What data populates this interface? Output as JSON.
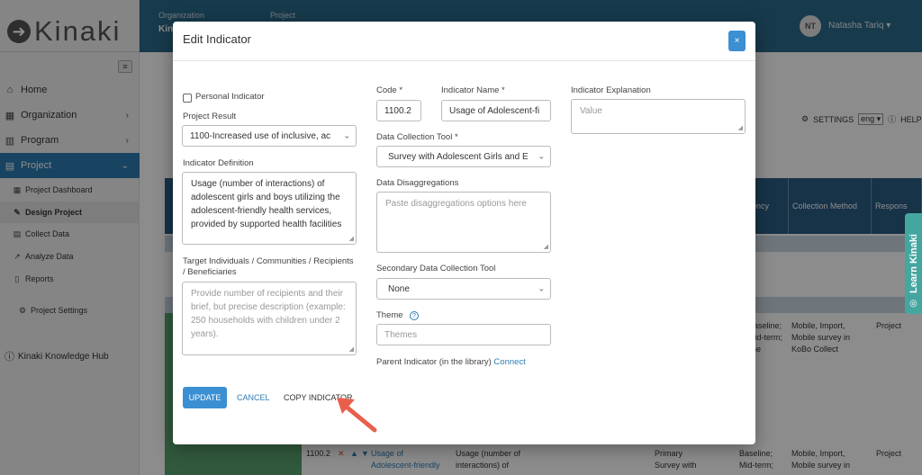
{
  "app": {
    "logo_text": "Kinaki",
    "topbar": {
      "org_label": "Organization",
      "org_value": "Kin",
      "project_label": "Project",
      "user_initials": "NT",
      "user_name": "Natasha Tariq ▾"
    }
  },
  "sidebar": {
    "collapse_icon": "≡",
    "items": [
      {
        "label": "Home",
        "icon": "⌂"
      },
      {
        "label": "Organization",
        "icon": "▦"
      },
      {
        "label": "Program",
        "icon": "▥"
      },
      {
        "label": "Project",
        "icon": "▤"
      }
    ],
    "sub_items": [
      {
        "label": "Project Dashboard"
      },
      {
        "label": "Design Project"
      },
      {
        "label": "Collect Data"
      },
      {
        "label": "Analyze Data"
      },
      {
        "label": "Reports"
      },
      {
        "label": "Project Settings"
      }
    ],
    "hub_label": "Kinaki Knowledge Hub"
  },
  "background": {
    "settings_label": "SETTINGS",
    "lang_value": "eng ▾",
    "help_label": "HELP",
    "table_headers": {
      "frequency": "uency",
      "collection_method": "Collection Method",
      "responsible": "Respons"
    },
    "row1": {
      "frequency": "Baseline;\nMid-term;\nline",
      "method": "Mobile, Import,\nMobile survey in\nKoBo Collect",
      "responsible": "Project"
    },
    "row2": {
      "code": "1100.2",
      "name": "Usage of\nAdolescent-friendly",
      "definition": "Usage (number of\ninteractions) of",
      "tool": "Primary\nSurvey with",
      "frequency": "Baseline;\nMid-term;",
      "method": "Mobile, Import,\nMobile survey in",
      "responsible": "Project"
    }
  },
  "learn_tab": {
    "label": "Learn Kinaki",
    "icon": "◎"
  },
  "modal": {
    "title": "Edit Indicator",
    "close_label": "×",
    "personal_indicator_label": "Personal Indicator",
    "project_result_label": "Project Result",
    "project_result_value": "1100-Increased use of inclusive, ac",
    "indicator_definition_label": "Indicator Definition",
    "indicator_definition_value": "Usage (number of interactions) of adolescent girls and boys utilizing the adolescent-friendly health services, provided by supported health facilities",
    "target_label": "Target Individuals / Communities / Recipients / Beneficiaries",
    "target_placeholder": "Provide number of recipients and their brief, but precise description (example: 250 households with children under 2 years).",
    "code_label": "Code *",
    "code_value": "1100.2",
    "indicator_name_label": "Indicator Name *",
    "indicator_name_value": "Usage of Adolescent-fi",
    "data_collection_tool_label": "Data Collection Tool *",
    "data_collection_tool_value": "Survey with Adolescent Girls and E",
    "data_disaggregations_label": "Data Disaggregations",
    "data_disaggregations_placeholder": "Paste disaggregations options here",
    "secondary_tool_label": "Secondary Data Collection Tool",
    "secondary_tool_value": "None",
    "theme_label": "Theme",
    "themes_placeholder": "Themes",
    "parent_indicator_label": "Parent Indicator (in the library)",
    "connect_label": "Connect",
    "indicator_explanation_label": "Indicator Explanation",
    "indicator_explanation_placeholder": "Value",
    "update_label": "UPDATE",
    "cancel_label": "CANCEL",
    "copy_label": "COPY INDICATOR"
  },
  "colors": {
    "brand_blue": "#3b8fd3",
    "topbar": "#2b6b8a",
    "nav_active": "#2d7db3",
    "learn_tab": "#45a6a0",
    "arrow": "#e8604c"
  }
}
